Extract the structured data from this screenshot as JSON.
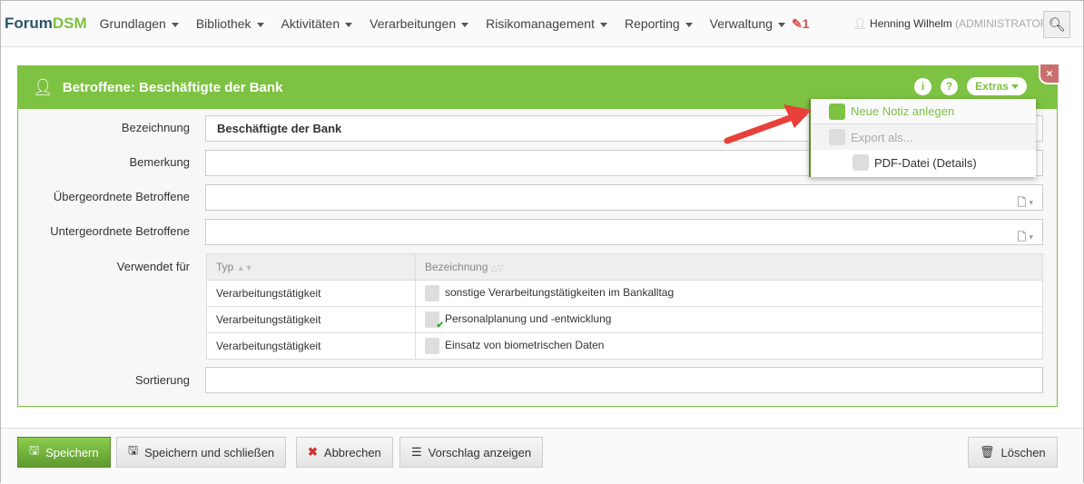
{
  "nav": {
    "logo_a": "Forum",
    "logo_b": "DSM",
    "items": [
      "Grundlagen",
      "Bibliothek",
      "Aktivitäten",
      "Verarbeitungen",
      "Risikomanagement",
      "Reporting",
      "Verwaltung"
    ],
    "notifications": "1",
    "user": "Henning Wilhelm",
    "role": "(ADMINISTRATOR)"
  },
  "panel": {
    "title": "Betroffene: Beschäftigte der Bank",
    "extras": "Extras",
    "info": "i",
    "help": "?",
    "close": "×"
  },
  "form": {
    "bezeichnung_label": "Bezeichnung",
    "bezeichnung_value": "Beschäftigte der Bank",
    "bemerkung_label": "Bemerkung",
    "uebergeordnet_label": "Übergeordnete Betroffene",
    "untergeordnet_label": "Untergeordnete Betroffene",
    "verwendet_label": "Verwendet für",
    "sortierung_label": "Sortierung"
  },
  "table": {
    "headers": [
      "Typ",
      "Bezeichnung"
    ],
    "rows": [
      {
        "typ": "Verarbeitungstätigkeit",
        "name": "sonstige Verarbeitungstätigkeiten im Bankalltag"
      },
      {
        "typ": "Verarbeitungstätigkeit",
        "name": "Personalplanung und -entwicklung"
      },
      {
        "typ": "Verarbeitungstätigkeit",
        "name": "Einsatz von biometrischen Daten"
      }
    ]
  },
  "menu": {
    "new_note": "Neue Notiz anlegen",
    "export": "Export als...",
    "pdf": "PDF-Datei (Details)"
  },
  "footer": {
    "save": "Speichern",
    "save_close": "Speichern und schließen",
    "cancel": "Abbrechen",
    "suggest": "Vorschlag anzeigen",
    "delete": "Löschen"
  },
  "colors": {
    "accent": "#7dc242",
    "danger": "#d9534f",
    "arrow": "#e8403a"
  }
}
